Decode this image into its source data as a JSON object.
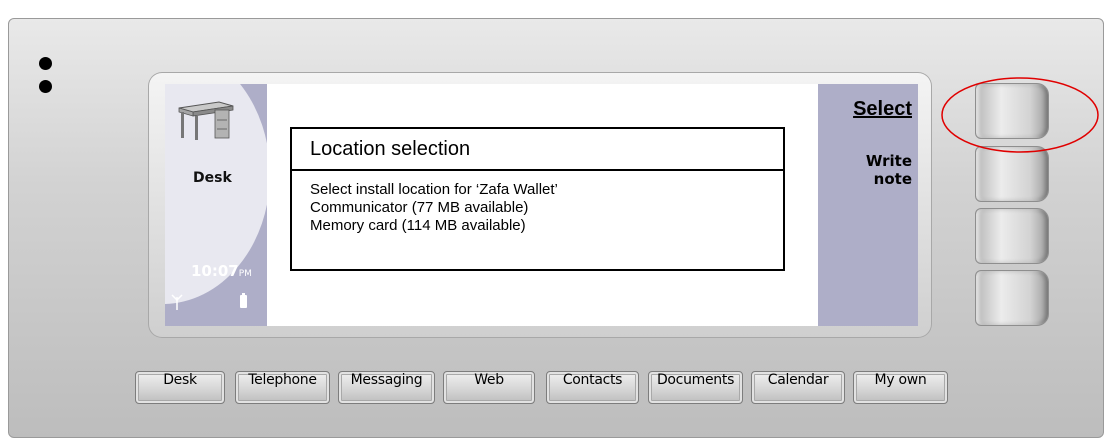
{
  "screen": {
    "left_panel": {
      "title": "Desk",
      "time": "10:07",
      "time_suffix": "PM"
    },
    "dialog": {
      "title": "Location selection",
      "prompt": "Select install location for ‘Zafa Wallet’",
      "options": [
        "Communicator (77 MB available)",
        "Memory card (114 MB available)"
      ]
    },
    "softkeys": {
      "select": "Select",
      "write_note": "Write note"
    }
  },
  "app_buttons": [
    "Desk",
    "Telephone",
    "Messaging",
    "Web",
    "Contacts",
    "Documents",
    "Calendar",
    "My own"
  ],
  "colors": {
    "panel": "#aeaec8",
    "highlight_ellipse": "#e00000",
    "screen_bg": "#ffffff"
  },
  "icons": {
    "desk": "desk-icon",
    "signal": "signal-icon",
    "battery": "battery-icon"
  }
}
